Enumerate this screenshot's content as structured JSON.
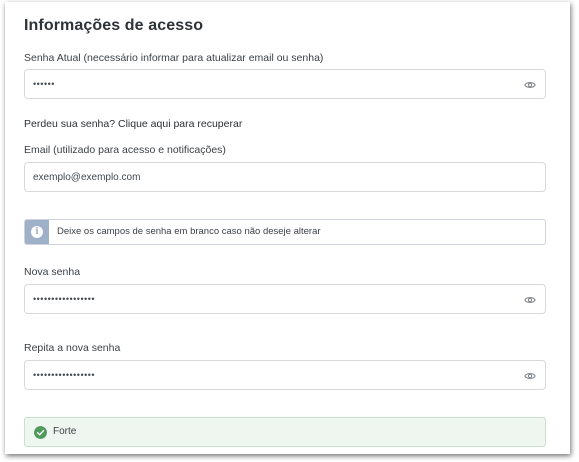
{
  "section": {
    "title": "Informações de acesso"
  },
  "current_password": {
    "label": "Senha Atual (necessário informar para atualizar email ou senha)",
    "value": "••••••"
  },
  "recover_link": "Perdeu sua senha? Clique aqui para recuperar",
  "email": {
    "label": "Email (utilizado para acesso e notificações)",
    "value": "exemplo@exemplo.com"
  },
  "info_alert": {
    "text": "Deixe os campos de senha em branco caso não deseje alterar",
    "icon": "info-icon"
  },
  "new_password": {
    "label": "Nova senha",
    "value": "•••••••••••••••••"
  },
  "repeat_password": {
    "label": "Repita a nova senha",
    "value": "•••••••••••••••••"
  },
  "strength": {
    "text": "Forte",
    "icon": "check-circle-icon"
  },
  "colors": {
    "info_accent": "#9fb1c9",
    "success_bg": "#eef6ef",
    "success_icon": "#4f9a5a",
    "border": "#d6d9dc"
  }
}
